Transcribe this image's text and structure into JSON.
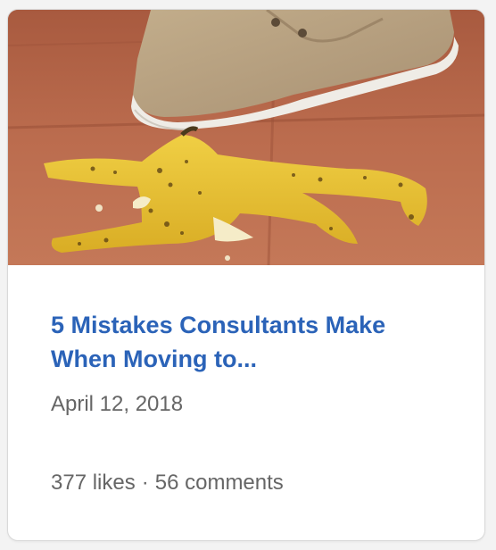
{
  "post": {
    "image_alt": "Shoe stepping on a banana peel",
    "title": "5 Mistakes Consultants Make When Moving to...",
    "date": "April 12, 2018",
    "likes": "377 likes",
    "separator": "·",
    "comments": "56 comments"
  },
  "colors": {
    "title": "#2b63b8",
    "meta": "#666666",
    "floor": "#b8694c",
    "banana": "#e6c032"
  }
}
